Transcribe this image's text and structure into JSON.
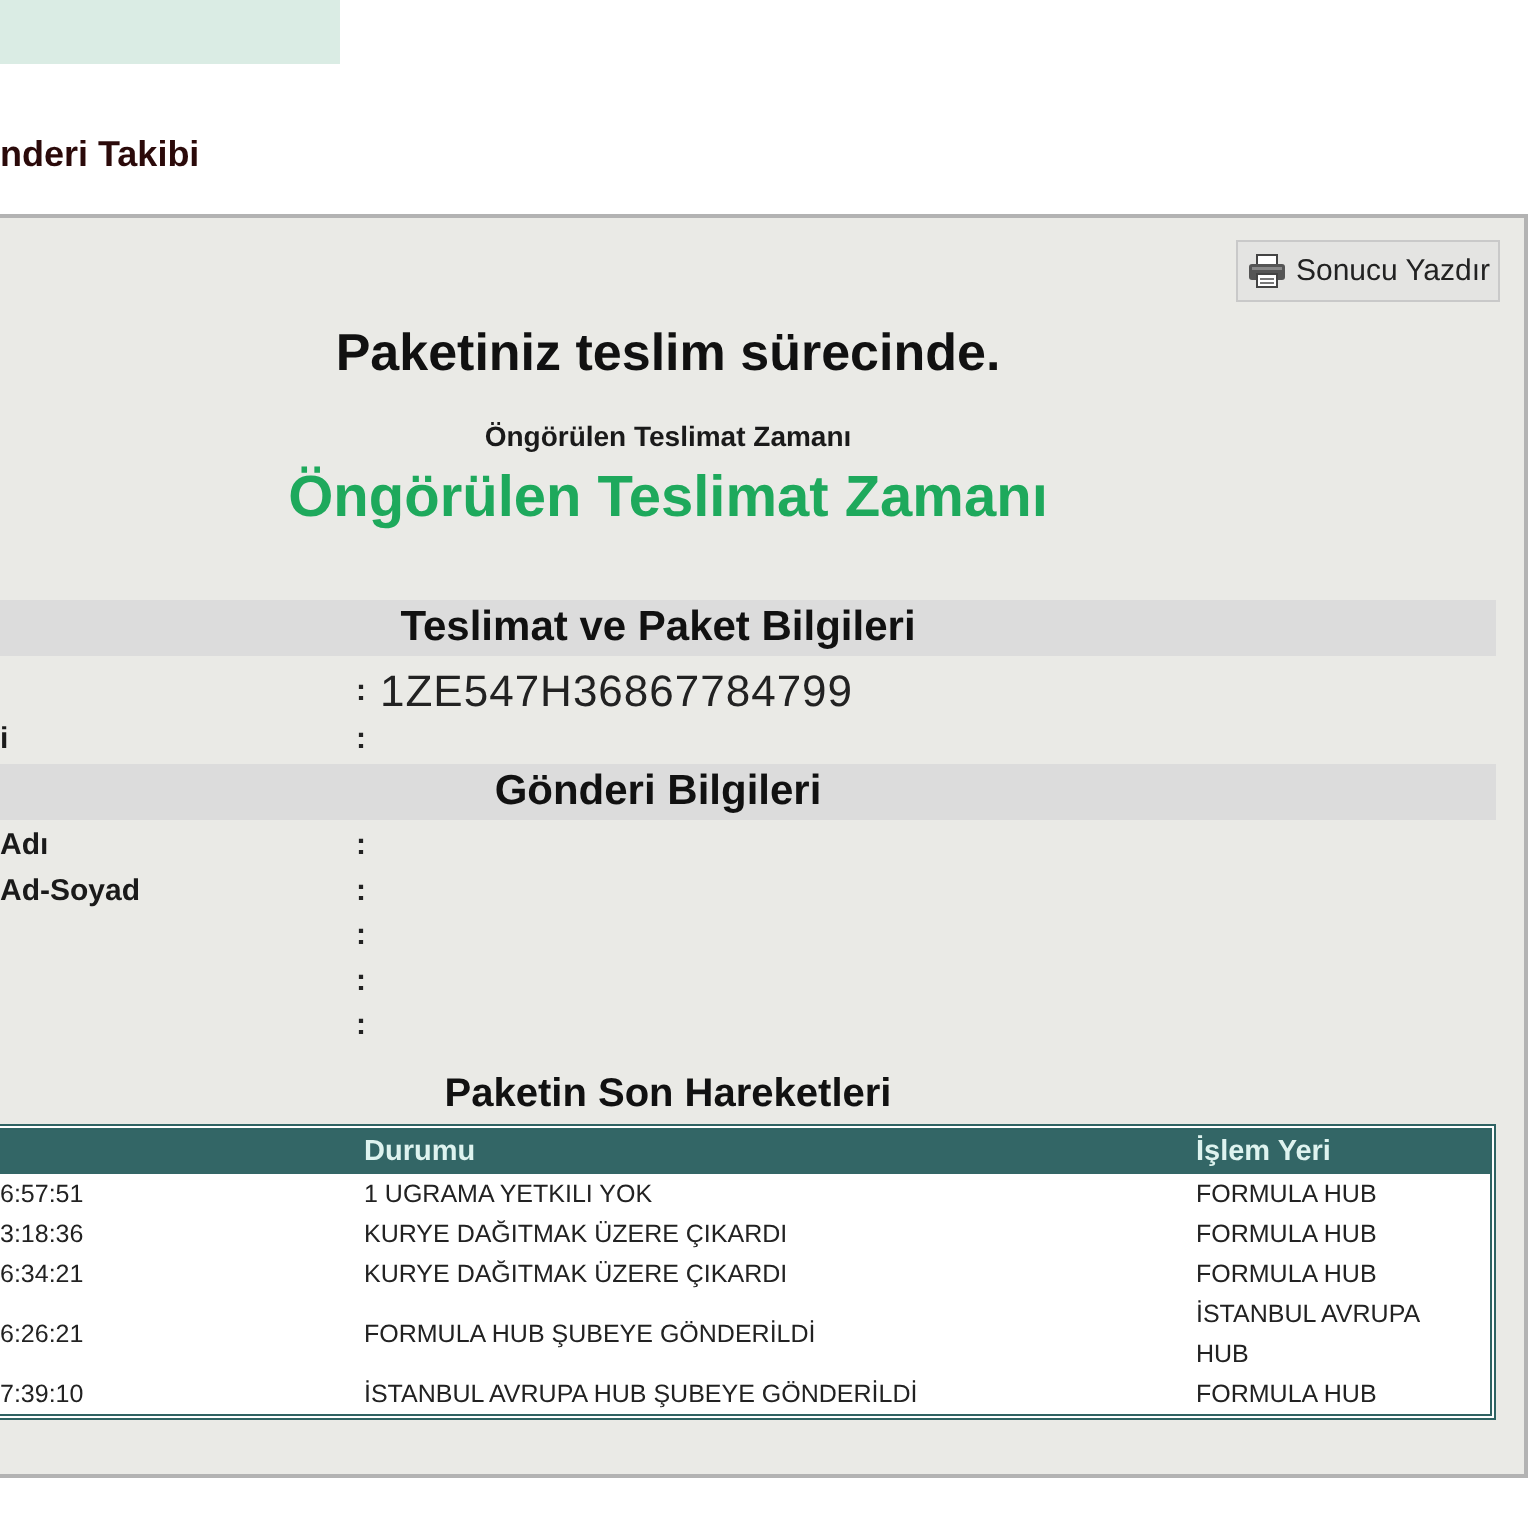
{
  "page_title": "nderi Takibi",
  "panel": {
    "print_button": "Sonucu Yazdır",
    "status": "Paketiniz teslim sürecinde.",
    "estimate_label": "Öngörülen Teslimat Zamanı",
    "estimate_value": "Öngörülen Teslimat Zamanı",
    "sections": [
      {
        "title": "Teslimat ve Paket Bilgileri",
        "rows": [
          {
            "separator": ":",
            "value": "1ZE547H36867784799"
          },
          {
            "label": "i",
            "separator": ":"
          }
        ]
      },
      {
        "title": "Gönderi Bilgileri",
        "rows": [
          {
            "label": "Adı",
            "separator": ":"
          },
          {
            "label": "Ad-Soyad",
            "separator": ":"
          },
          {
            "separator": ":"
          },
          {
            "separator": ":"
          },
          {
            "separator": ":"
          }
        ]
      }
    ],
    "movements": {
      "title": "Paketin Son Hareketleri",
      "headers": {
        "status": "Durumu",
        "location": "İşlem Yeri"
      },
      "rows": [
        {
          "time": "6:57:51",
          "status": "1 UGRAMA YETKILI YOK",
          "location": "FORMULA HUB"
        },
        {
          "time": "3:18:36",
          "status": "KURYE DAĞITMAK ÜZERE ÇIKARDI",
          "location": "FORMULA HUB"
        },
        {
          "time": "6:34:21",
          "status": "KURYE DAĞITMAK ÜZERE ÇIKARDI",
          "location": "FORMULA HUB"
        },
        {
          "time": "6:26:21",
          "status": "FORMULA HUB ŞUBEYE GÖNDERİLDİ",
          "location": "İSTANBUL AVRUPA HUB"
        },
        {
          "time": "7:39:10",
          "status": "İSTANBUL AVRUPA HUB ŞUBEYE GÖNDERİLDİ",
          "location": "FORMULA HUB"
        }
      ]
    }
  }
}
